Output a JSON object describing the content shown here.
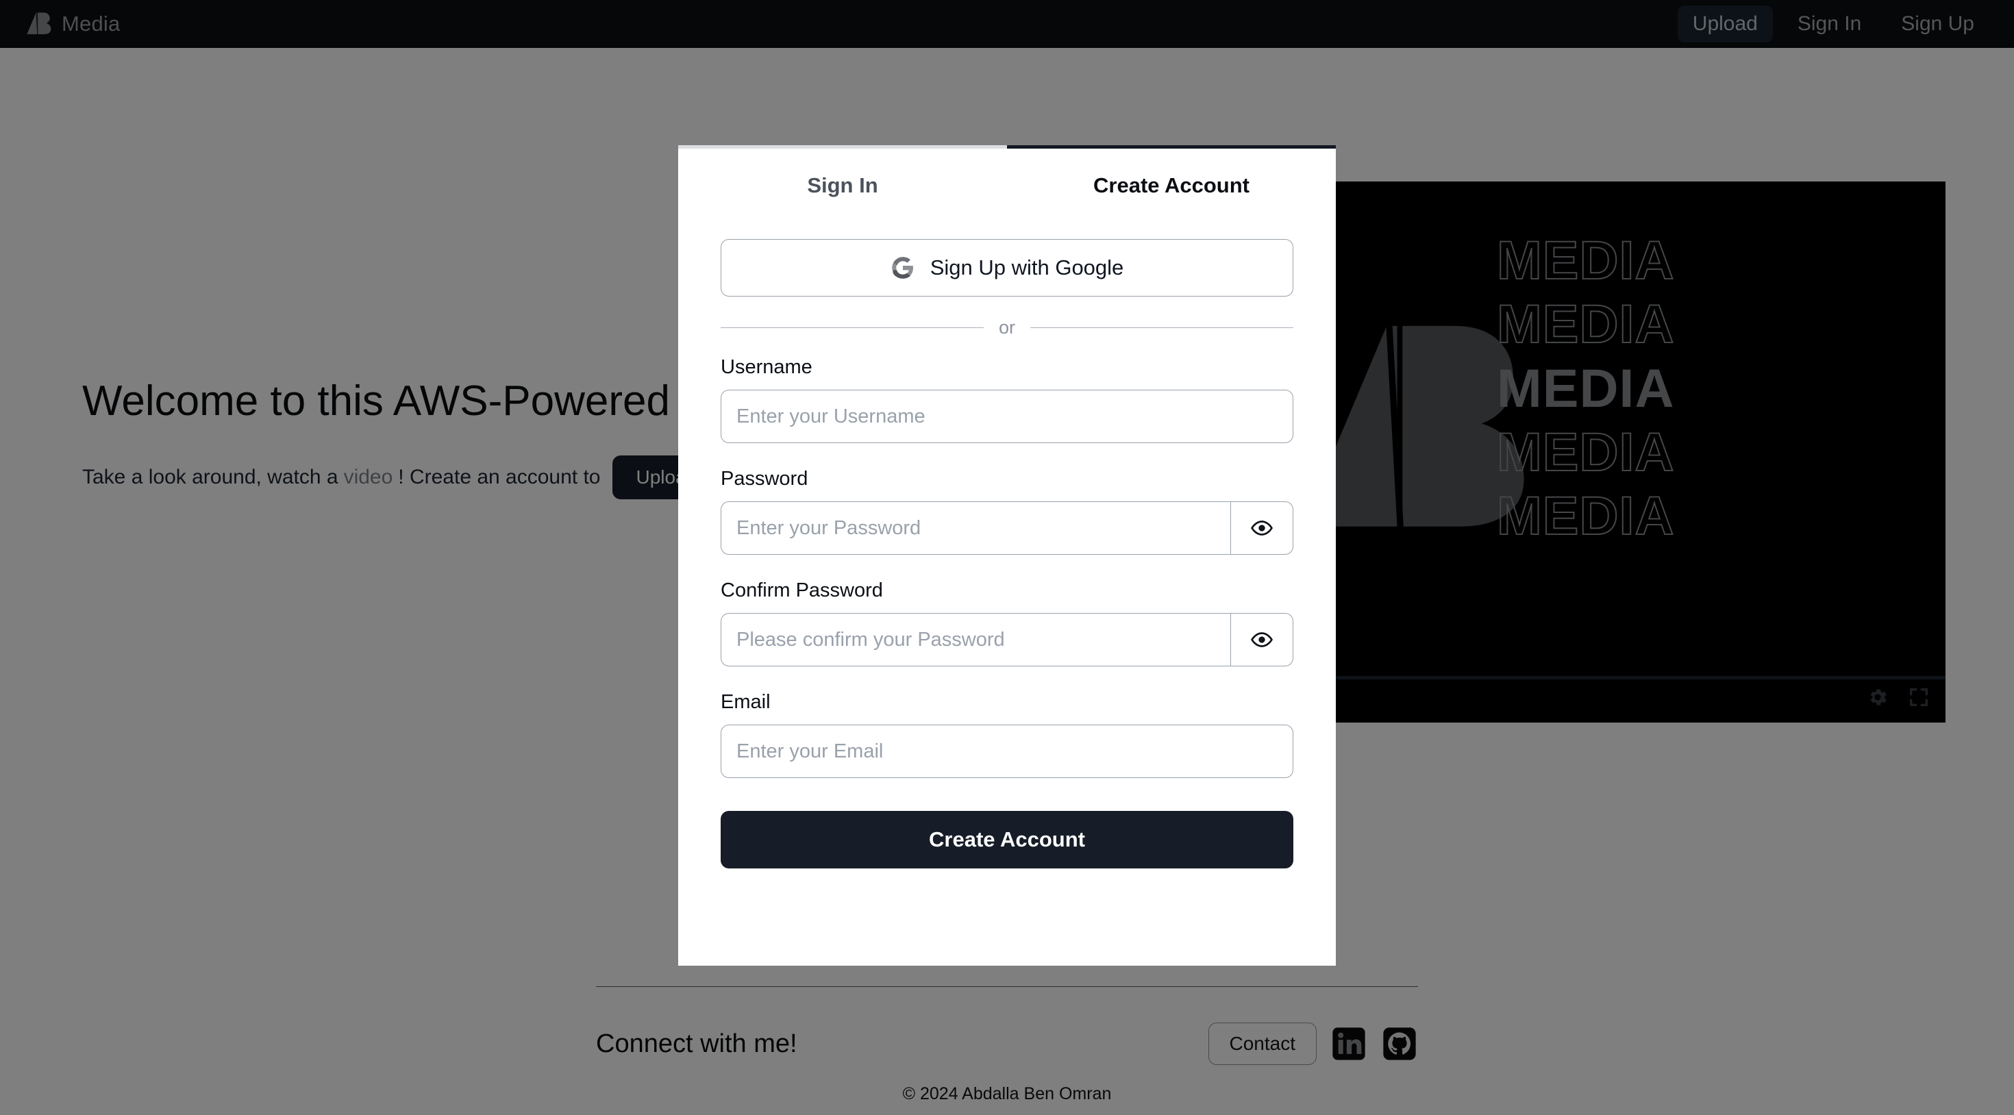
{
  "navbar": {
    "brand": "Media",
    "logo_icon": "ab-logo-icon",
    "links": [
      {
        "label": "Upload",
        "active": true
      },
      {
        "label": "Sign In",
        "active": false
      },
      {
        "label": "Sign Up",
        "active": false
      }
    ]
  },
  "hero": {
    "title": "Welcome to this AWS-Powered",
    "sub_before": "Take a look around, watch a",
    "sub_link": "video",
    "sub_after": "! Create an account to",
    "cta_label": "Upload"
  },
  "video": {
    "logo_icon": "ab-logo-icon",
    "words": [
      "MEDIA",
      "MEDIA",
      "MEDIA",
      "MEDIA",
      "MEDIA"
    ],
    "solid_index": 2,
    "settings_icon": "gear-icon",
    "fullscreen_icon": "fullscreen-icon"
  },
  "modal": {
    "tabs": [
      {
        "label": "Sign In",
        "active": false
      },
      {
        "label": "Create Account",
        "active": true
      }
    ],
    "google_button": {
      "label": "Sign Up with Google",
      "icon": "google-g-icon"
    },
    "divider_text": "or",
    "fields": [
      {
        "label": "Username",
        "placeholder": "Enter your Username",
        "value": "",
        "has_eye": false
      },
      {
        "label": "Password",
        "placeholder": "Enter your Password",
        "value": "",
        "has_eye": true
      },
      {
        "label": "Confirm Password",
        "placeholder": "Please confirm your Password",
        "value": "",
        "has_eye": true
      },
      {
        "label": "Email",
        "placeholder": "Enter your Email",
        "value": "",
        "has_eye": false
      }
    ],
    "submit_label": "Create Account",
    "eye_icon": "eye-icon"
  },
  "footer": {
    "title": "Connect with me!",
    "contact_label": "Contact",
    "linkedin_icon": "linkedin-icon",
    "github_icon": "github-icon",
    "copyright": "© 2024 Abdalla Ben Omran"
  },
  "colors": {
    "navbar_bg": "#0d0e10",
    "accent_dark": "#161d28",
    "overlay": "rgba(0,0,0,0.5)",
    "border": "#9aa1ab",
    "muted_text": "#9aa1ab"
  }
}
